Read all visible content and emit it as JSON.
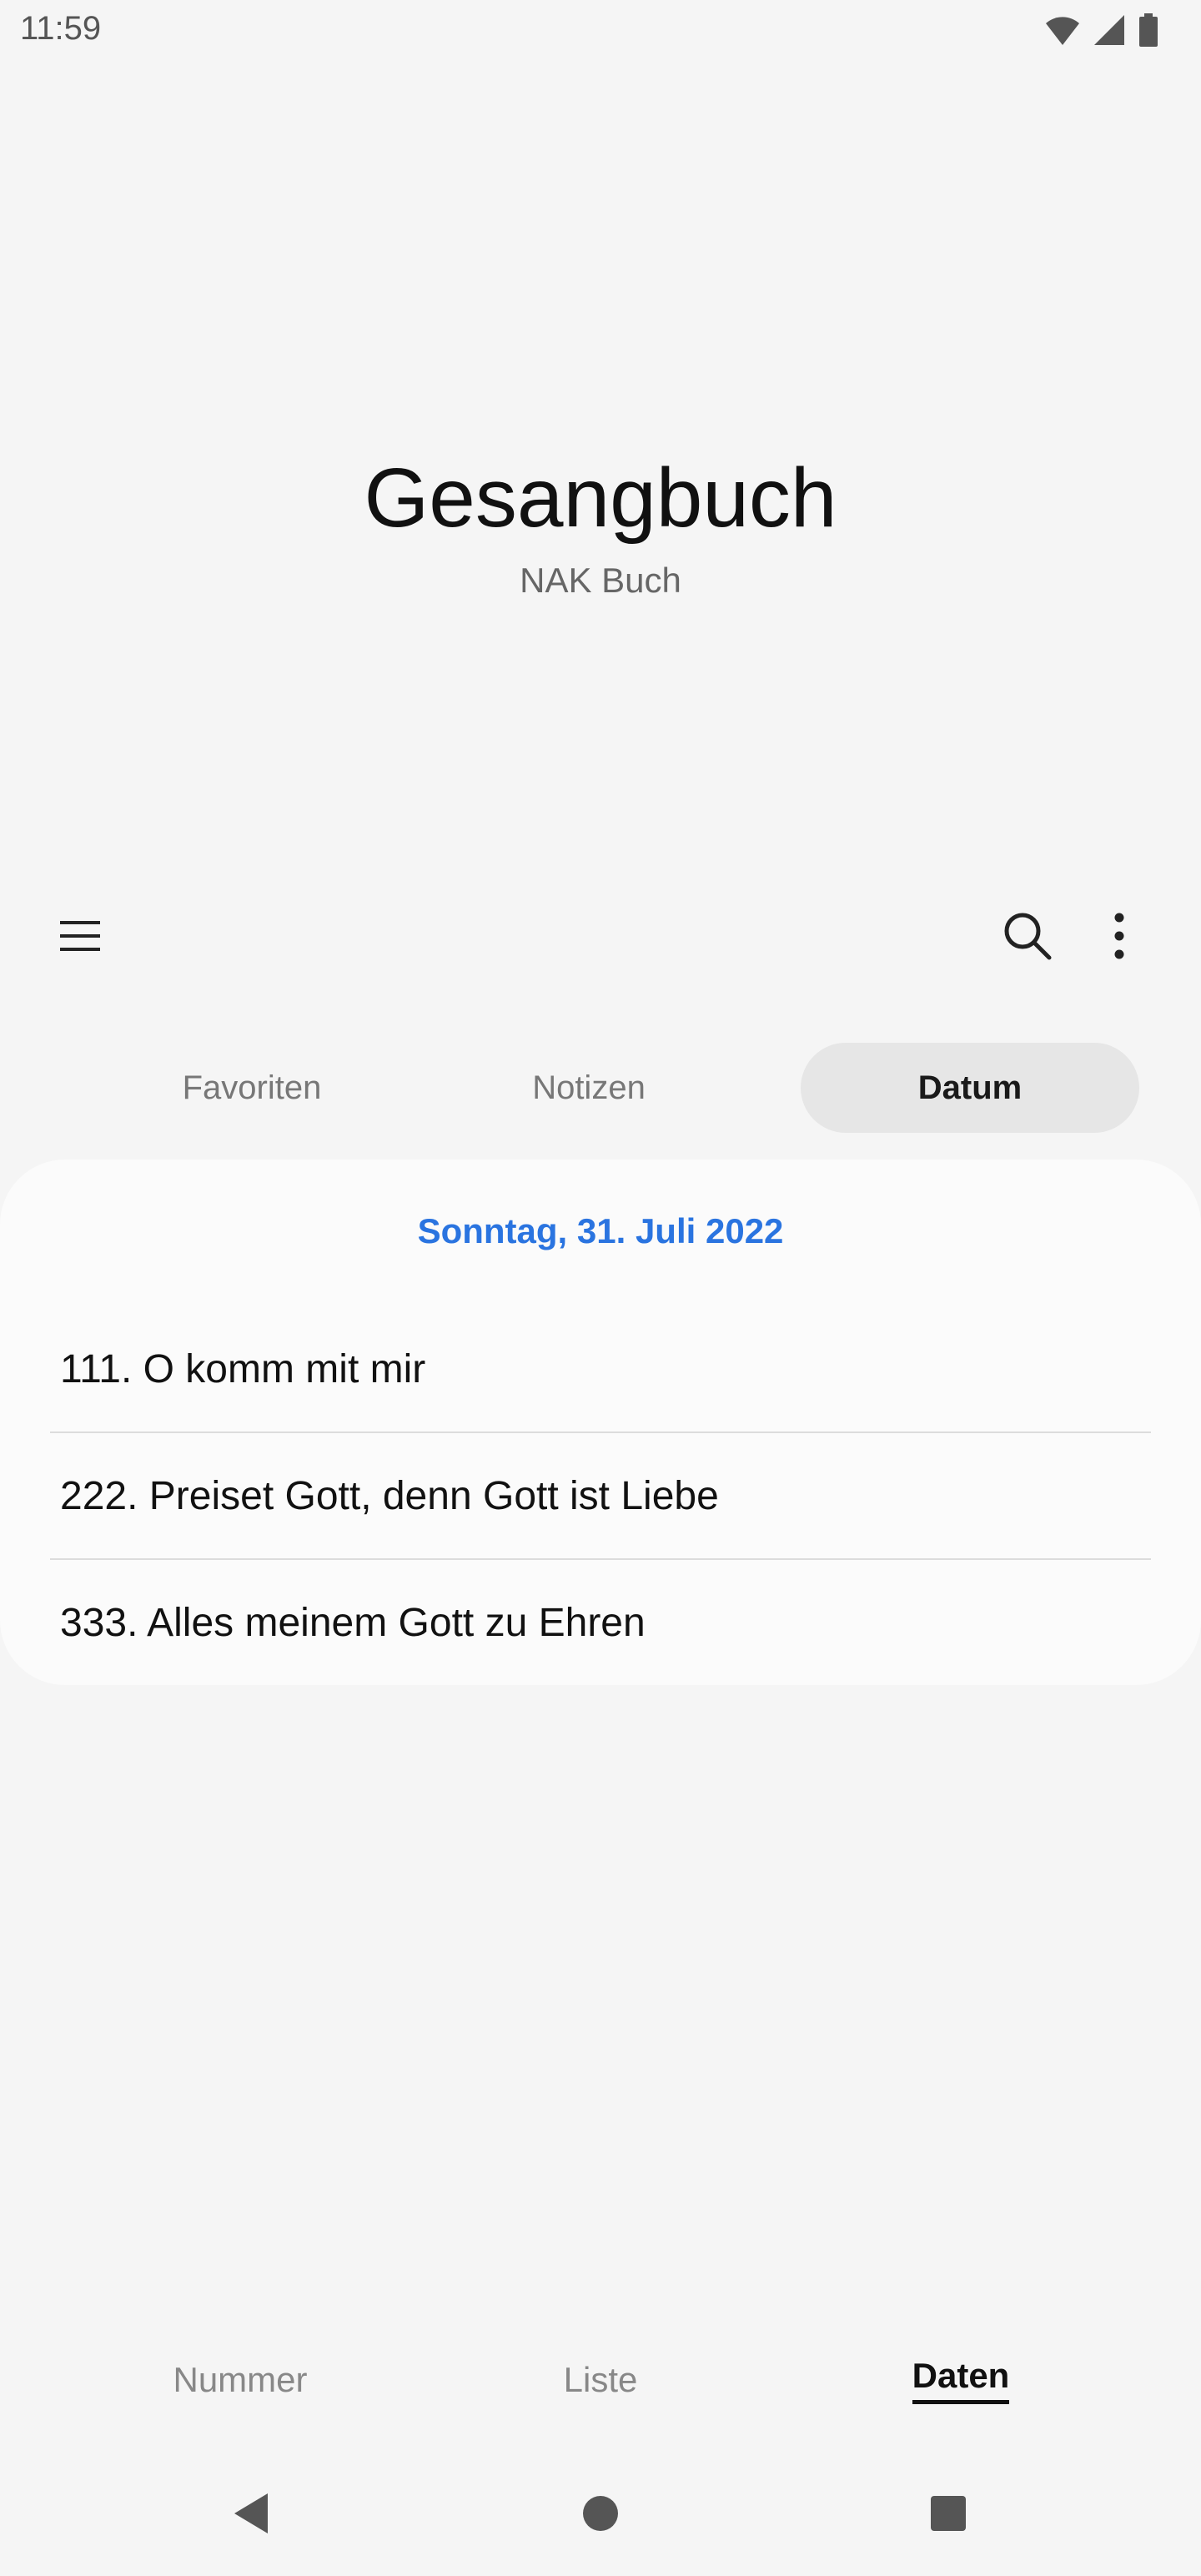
{
  "status_bar": {
    "time": "11:59",
    "icons": [
      "wifi-icon",
      "cellular-signal-icon",
      "battery-icon"
    ]
  },
  "header": {
    "title": "Gesangbuch",
    "subtitle": "NAK Buch"
  },
  "toolbar": {
    "icons": [
      "menu-icon",
      "search-icon",
      "more-vert-icon"
    ]
  },
  "tabs": [
    {
      "label": "Favoriten",
      "active": false
    },
    {
      "label": "Notizen",
      "active": false
    },
    {
      "label": "Datum",
      "active": true
    }
  ],
  "card": {
    "date": "Sonntag, 31. Juli 2022",
    "items": [
      {
        "label": "111. O komm mit mir"
      },
      {
        "label": "222. Preiset Gott, denn Gott ist Liebe"
      },
      {
        "label": "333. Alles meinem Gott zu Ehren"
      }
    ]
  },
  "bottom_nav": [
    {
      "label": "Nummer",
      "active": false
    },
    {
      "label": "Liste",
      "active": false
    },
    {
      "label": "Daten",
      "active": true
    }
  ],
  "system_nav": {
    "icons": [
      "back-icon",
      "home-icon",
      "recents-icon"
    ]
  },
  "colors": {
    "background": "#f5f5f5",
    "card": "#fbfbfb",
    "accent": "#2a74e0",
    "active_tab_bg": "#e6e6e6"
  }
}
